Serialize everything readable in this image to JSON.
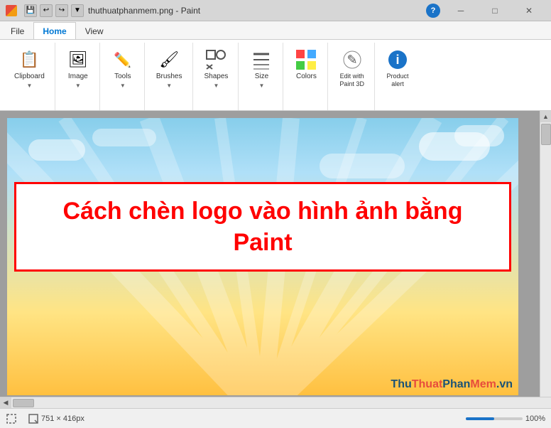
{
  "titlebar": {
    "title": "thuthuatphanmem.png - Paint",
    "icon": "paint-icon",
    "controls": {
      "minimize": "─",
      "maximize": "□",
      "close": "✕"
    },
    "help": "?"
  },
  "ribbon": {
    "tabs": [
      {
        "id": "file",
        "label": "File",
        "active": false
      },
      {
        "id": "home",
        "label": "Home",
        "active": true
      },
      {
        "id": "view",
        "label": "View",
        "active": false
      }
    ],
    "groups": [
      {
        "id": "clipboard",
        "label": "Clipboard",
        "items": [
          {
            "icon": "📋",
            "label": "Clipboard",
            "hasArrow": true
          }
        ]
      },
      {
        "id": "image",
        "label": "Image",
        "items": [
          {
            "icon": "🖼",
            "label": "Image",
            "hasArrow": true
          }
        ]
      },
      {
        "id": "tools",
        "label": "Tools",
        "items": [
          {
            "icon": "✏️",
            "label": "Tools",
            "hasArrow": true
          }
        ]
      },
      {
        "id": "brushes",
        "label": "Brushes",
        "items": [
          {
            "icon": "🖌",
            "label": "Brushes",
            "hasArrow": true
          }
        ]
      },
      {
        "id": "shapes",
        "label": "Shapes",
        "items": [
          {
            "icon": "⬛",
            "label": "Shapes",
            "hasArrow": true
          }
        ]
      },
      {
        "id": "size",
        "label": "Size",
        "items": [
          {
            "icon": "≡",
            "label": "Size",
            "hasArrow": true
          }
        ]
      },
      {
        "id": "colors",
        "label": "Colors",
        "items": [
          {
            "icon": "🎨",
            "label": "Colors",
            "hasArrow": false
          }
        ]
      },
      {
        "id": "edit-with-paint3d",
        "label": "Edit with\nPaint 3D",
        "items": [
          {
            "icon": "✏",
            "label": "Edit with\nPaint 3D",
            "hasArrow": false
          }
        ]
      },
      {
        "id": "product-alert",
        "label": "Product\nalert",
        "items": [
          {
            "icon": "ℹ",
            "label": "Product\nalert",
            "hasArrow": false
          }
        ]
      }
    ]
  },
  "canvas": {
    "image_title_line1": "Cách chèn logo vào hình ảnh bằng",
    "image_title_line2": "Paint",
    "watermark": {
      "part1": "Thu",
      "part2": "Thuat",
      "part3": "Phan",
      "part4": "Mem",
      "part5": ".vn"
    }
  },
  "statusbar": {
    "dims_label": "751 × 416px",
    "zoom_label": "100%",
    "scroll_left_arrow": "◀",
    "scroll_right_arrow": "▶",
    "scroll_up_arrow": "▲",
    "scroll_down_arrow": "▼"
  }
}
